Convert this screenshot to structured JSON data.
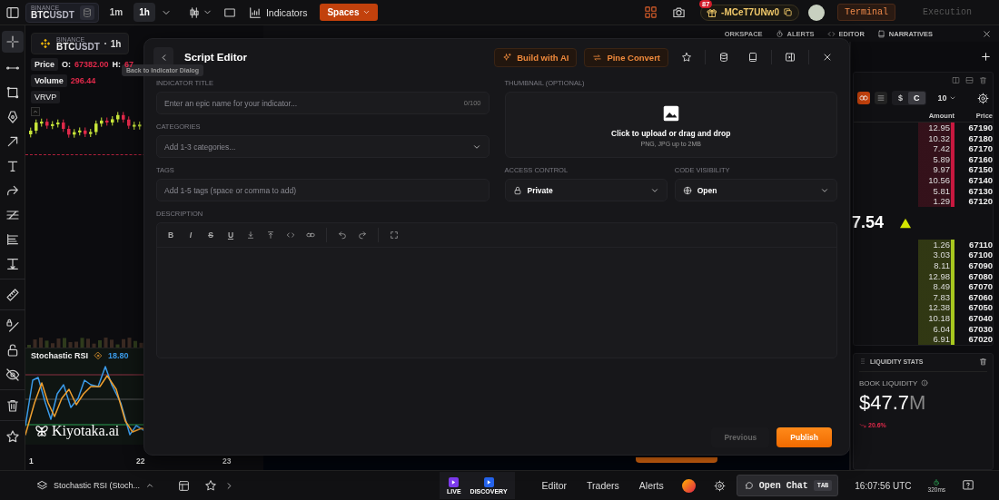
{
  "top_bar": {
    "symbol": {
      "exchange": "BINANCE",
      "base": "BTC",
      "quote": "USDT"
    },
    "intervals": [
      {
        "label": "1m",
        "selected": false
      },
      {
        "label": "1h",
        "selected": true
      }
    ],
    "indicators_label": "Indicators",
    "spaces_button": "Spaces",
    "notifications_badge": "87",
    "referral_code": "-MCeT7UNw0",
    "modes": [
      {
        "label": "Terminal",
        "selected": true
      },
      {
        "label": "Execution",
        "selected": false
      }
    ]
  },
  "chart": {
    "symbol": {
      "exchange": "BINANCE",
      "base": "BTC",
      "quote": "USDT",
      "interval": "1h"
    },
    "legend": {
      "price_label": "Price",
      "open_label": "O:",
      "open_value": "67382.00",
      "high_label": "H:",
      "high_value": "67"
    },
    "volume": {
      "label": "Volume",
      "value": "296.44"
    },
    "vrvp_label": "VRVP",
    "oscillator": {
      "name": "Stochastic RSI",
      "value": "18.80"
    },
    "x_labels": [
      "1",
      "22",
      "23"
    ],
    "brand": "Kiyotaka.ai"
  },
  "tooltip": "Back to Indicator Dialog",
  "workspace_tabs": [
    {
      "label": "ORKSPACE"
    },
    {
      "label": "ALERTS"
    },
    {
      "label": "EDITOR"
    },
    {
      "label": "NARRATIVES"
    }
  ],
  "order_book": {
    "currency_toggle": [
      {
        "label": "$",
        "selected": false
      },
      {
        "label": "C",
        "selected": true
      }
    ],
    "depth": "10",
    "columns": [
      "Amount",
      "Price"
    ],
    "asks": [
      {
        "amount": "12.95",
        "price": "67190"
      },
      {
        "amount": "10.32",
        "price": "67180"
      },
      {
        "amount": "7.42",
        "price": "67170"
      },
      {
        "amount": "5.89",
        "price": "67160"
      },
      {
        "amount": "9.97",
        "price": "67150"
      },
      {
        "amount": "10.56",
        "price": "67140"
      },
      {
        "amount": "5.81",
        "price": "67130"
      },
      {
        "amount": "1.29",
        "price": "67120"
      }
    ],
    "last_price": "7.54",
    "bids": [
      {
        "amount": "1.26",
        "price": "67110"
      },
      {
        "amount": "3.03",
        "price": "67100"
      },
      {
        "amount": "8.11",
        "price": "67090"
      },
      {
        "amount": "12.98",
        "price": "67080"
      },
      {
        "amount": "8.49",
        "price": "67070"
      },
      {
        "amount": "7.83",
        "price": "67060"
      },
      {
        "amount": "12.38",
        "price": "67050"
      },
      {
        "amount": "10.18",
        "price": "67040"
      },
      {
        "amount": "6.04",
        "price": "67030"
      },
      {
        "amount": "6.91",
        "price": "67020"
      }
    ]
  },
  "liquidity": {
    "title": "LIQUIDITY STATS",
    "label": "BOOK LIQUIDITY",
    "value": "$47.7",
    "unit": "M",
    "change": "20.6%"
  },
  "script_editor": {
    "title": "Script Editor",
    "actions": [
      "Build with AI",
      "Pine Convert"
    ],
    "indicator_title": {
      "label": "INDICATOR TITLE",
      "placeholder": "Enter an epic name for your indicator...",
      "counter": "0/100"
    },
    "categories": {
      "label": "CATEGORIES",
      "placeholder": "Add 1-3 categories..."
    },
    "tags": {
      "label": "TAGS",
      "placeholder": "Add 1-5 tags (space or comma to add)"
    },
    "thumbnail": {
      "label": "THUMBNAIL (OPTIONAL)",
      "prompt": "Click to upload or drag and drop",
      "hint": "PNG, JPG up to 2MB"
    },
    "access_control": {
      "label": "ACCESS CONTROL",
      "value": "Private"
    },
    "code_visibility": {
      "label": "CODE VISIBILITY",
      "value": "Open"
    },
    "description": {
      "label": "DESCRIPTION",
      "format_buttons": [
        "B",
        "I",
        "S",
        "U"
      ]
    },
    "previous": {
      "label": "Previous",
      "disabled": true
    },
    "publish": {
      "label": "Publish"
    }
  },
  "bottom_bar": {
    "indicator": "Stochastic RSI (Stoch...",
    "live_label": "LIVE",
    "discovery_label": "DISCOVERY",
    "nav": [
      "Editor",
      "Traders",
      "Alerts"
    ],
    "chat_button": "Open Chat",
    "chat_shortcut": "TAB",
    "time": "16:07:56 UTC",
    "latency": "320ms"
  }
}
